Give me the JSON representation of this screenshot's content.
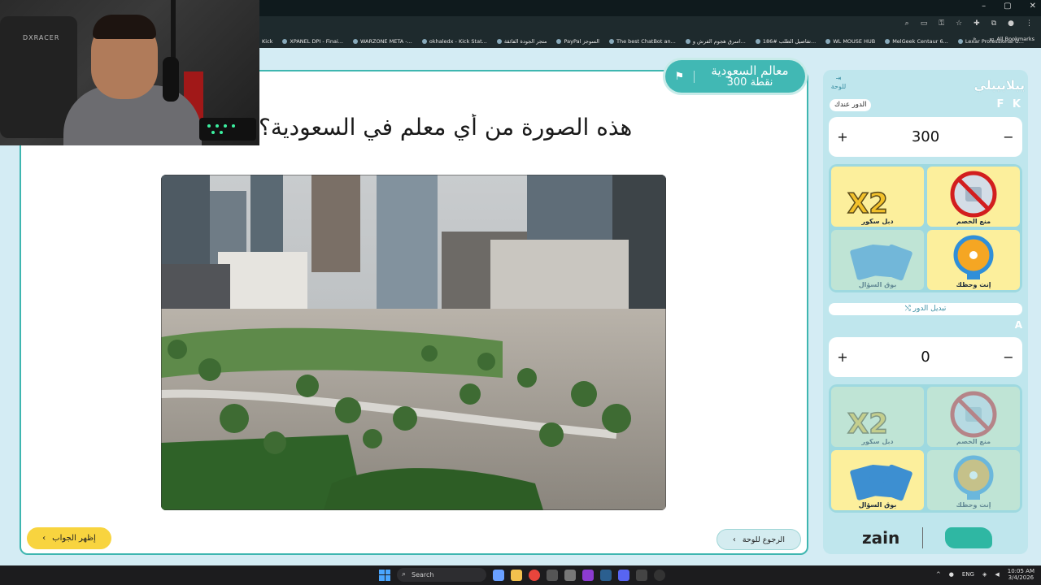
{
  "browser": {
    "bookmarks": [
      "Kick",
      "XPANEL DPI - Finai...",
      "WARZONE META -...",
      "okhaledx - Kick Stat...",
      "متجر الجودة الفائقة",
      "PayPal السوجز",
      "The best ChatBot an...",
      "اسرق هجوم الفرش و...",
      "تفاصيل الطلب #186...",
      "WL MOUSE HUB",
      "MelGeek Centaur 6...",
      "Lexar Professional U..."
    ],
    "all_bookmarks": "All Bookmarks"
  },
  "webcam": {
    "chair_brand": "DXRACER"
  },
  "category": {
    "name": "معالم السعودية",
    "points": "300 نقطة"
  },
  "question": {
    "text": "هذه الصورة من أي معلم في السعودية؟"
  },
  "buttons": {
    "show_answer": "إظهر الجواب",
    "back_to_board": "الرجوع للوحة"
  },
  "team1": {
    "name": "يبلابيبلي",
    "board_link": "للوحة",
    "turn_label": "الدور عندك",
    "code": "F K",
    "score": "300",
    "helpers": [
      "منع الخصم",
      "دبل سكور",
      "إنت وحظك",
      "بوق السؤال"
    ]
  },
  "switch_turn": "تبديل الدور",
  "team2": {
    "code": "A",
    "score": "0",
    "helpers": [
      "منع الخصم",
      "دبل سكور",
      "إنت وحظك",
      "بوق السؤال"
    ]
  },
  "sponsor": {
    "name": "zain"
  },
  "taskbar": {
    "search": "Search",
    "lang": "ENG",
    "time": "10:05 AM",
    "date": "3/4/2026"
  }
}
